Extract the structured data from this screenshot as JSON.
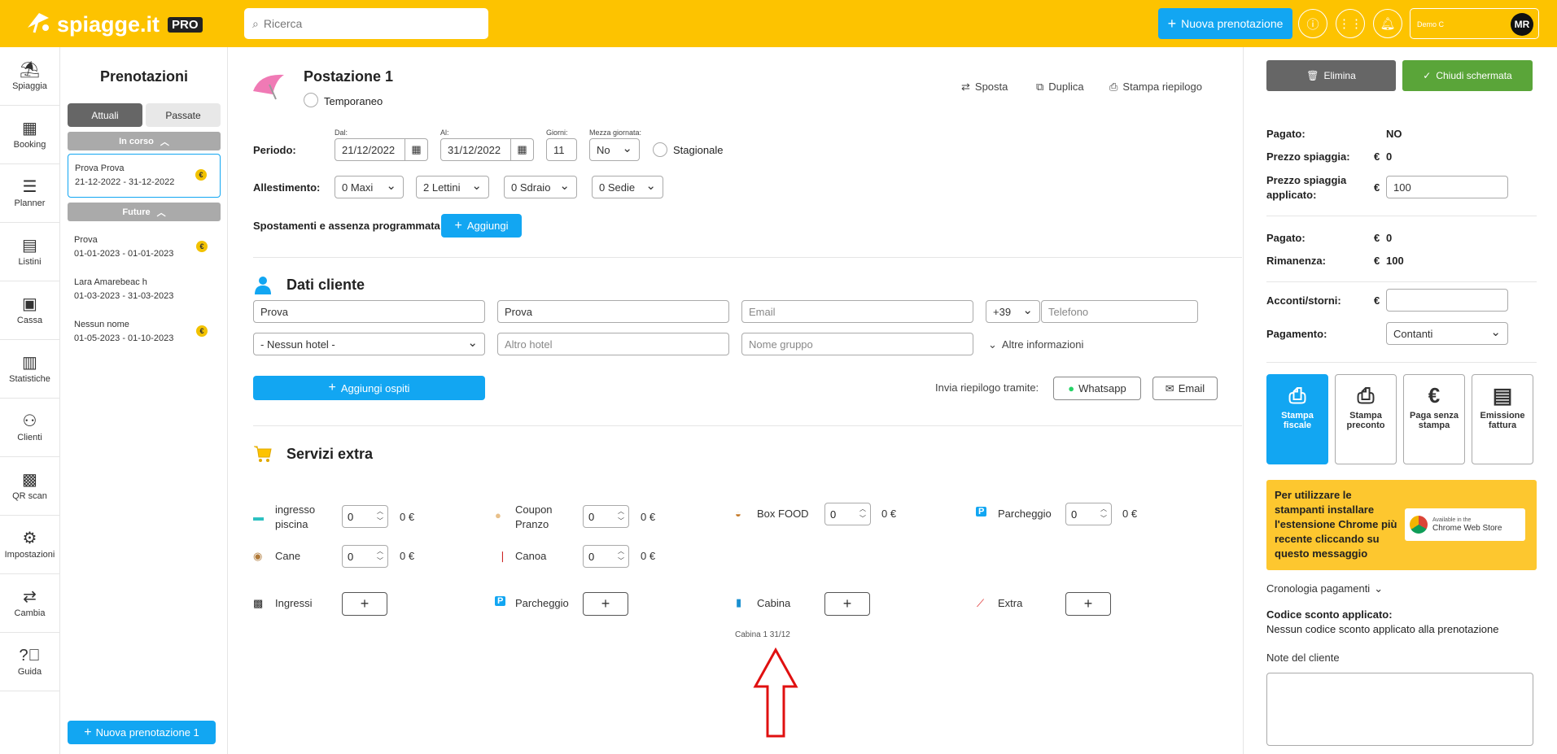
{
  "app": {
    "logo": "spiagge.it",
    "pro": "PRO",
    "search_placeholder": "Ricerca",
    "new_booking": "Nuova prenotazione",
    "user": "Demo C",
    "avatar": "MR"
  },
  "nav": [
    "Spiaggia",
    "Booking",
    "Planner",
    "Listini",
    "Cassa",
    "Statistiche",
    "Clienti",
    "QR scan",
    "Impostazioni",
    "Cambia",
    "Guida"
  ],
  "bookings": {
    "title": "Prenotazioni",
    "tabs": [
      "Attuali",
      "Passate"
    ],
    "in_corso": "In corso",
    "future": "Future",
    "current": [
      {
        "name": "Prova Prova",
        "dates": "21-12-2022 - 31-12-2022"
      }
    ],
    "future_items": [
      {
        "name": "Prova",
        "dates": "01-01-2023 - 01-01-2023"
      },
      {
        "name": "Lara Amarebeac h",
        "dates": "01-03-2023 - 31-03-2023"
      },
      {
        "name": "Nessun nome",
        "dates": "01-05-2023 - 01-10-2023"
      }
    ],
    "new_button": "Nuova prenotazione 1"
  },
  "main": {
    "title": "Postazione 1",
    "temporaneo": "Temporaneo",
    "actions": [
      "Sposta",
      "Duplica",
      "Stampa riepilogo"
    ],
    "periodo": "Periodo:",
    "dal_label": "Dal:",
    "dal": "21/12/2022",
    "al_label": "Al:",
    "al": "31/12/2022",
    "giorni_label": "Giorni:",
    "giorni": "11",
    "mezza_label": "Mezza giornata:",
    "mezza": "No",
    "stagionale": "Stagionale",
    "allestimento": "Allestimento:",
    "allest": [
      "0 Maxi",
      "2 Lettini",
      "0 Sdraio",
      "0 Sedie"
    ],
    "spostamenti": "Spostamenti e assenza programmata:",
    "aggiungi": "Aggiungi",
    "dati_cliente": "Dati cliente",
    "nome": "Prova",
    "cognome": "Prova",
    "email_ph": "Email",
    "prefix": "+39",
    "tel_ph": "Telefono",
    "hotel": "- Nessun hotel -",
    "altro_hotel_ph": "Altro hotel",
    "gruppo_ph": "Nome gruppo",
    "altre_info": "Altre informazioni",
    "aggiungi_ospiti": "Aggiungi ospiti",
    "invia": "Invia riepilogo tramite:",
    "whatsapp": "Whatsapp",
    "email_btn": "Email",
    "servizi": "Servizi extra",
    "services": [
      {
        "name": "ingresso piscina",
        "qty": "0",
        "price": "0 €"
      },
      {
        "name": "Coupon Pranzo",
        "qty": "0",
        "price": "0 €"
      },
      {
        "name": "Box FOOD",
        "qty": "0",
        "price": "0 €"
      },
      {
        "name": "Parcheggio",
        "qty": "0",
        "price": "0 €"
      },
      {
        "name": "Cane",
        "qty": "0",
        "price": "0 €"
      },
      {
        "name": "Canoa",
        "qty": "0",
        "price": "0 €"
      }
    ],
    "extras": [
      "Ingressi",
      "Parcheggio",
      "Cabina",
      "Extra"
    ],
    "cabina_note": "Cabina 1 31/12"
  },
  "right": {
    "elimina": "Elimina",
    "chiudi": "Chiudi schermata",
    "pagato_label": "Pagato:",
    "pagato_val": "NO",
    "prezzo_label": "Prezzo spiaggia:",
    "prezzo_cur": "€",
    "prezzo_val": "0",
    "prezzo_app_label": "Prezzo spiaggia applicato:",
    "prezzo_app_cur": "€",
    "prezzo_app_val": "100",
    "pagato2_label": "Pagato:",
    "pagato2_cur": "€",
    "pagato2_val": "0",
    "rimanenza_label": "Rimanenza:",
    "rimanenza_cur": "€",
    "rimanenza_val": "100",
    "acconti_label": "Acconti/storni:",
    "acconti_cur": "€",
    "pagamento_label": "Pagamento:",
    "pagamento_val": "Contanti",
    "cards": [
      "Stampa fiscale",
      "Stampa preconto",
      "Paga senza stampa",
      "Emissione fattura"
    ],
    "notice": "Per utilizzare le stampanti installare l'estensione Chrome più recente cliccando su questo messaggio",
    "store_small": "Available in the",
    "store_big": "Chrome Web Store",
    "cronologia": "Cronologia pagamenti",
    "codice_label": "Codice sconto applicato:",
    "codice_val": "Nessun codice sconto applicato alla prenotazione",
    "note_label": "Note del cliente"
  },
  "colors": {
    "brand": "#fdc300",
    "primary": "#12a6f2",
    "green": "#5aa539",
    "dark": "#666666"
  }
}
